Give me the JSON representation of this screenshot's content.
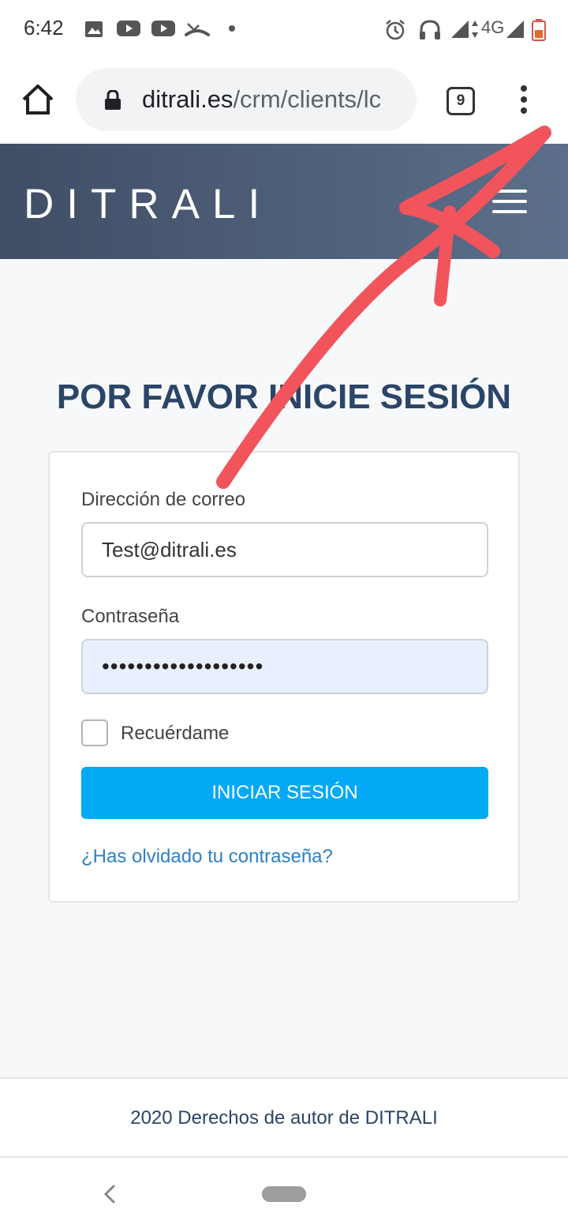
{
  "status_bar": {
    "time": "6:42",
    "network": "4G",
    "icons": [
      "image-icon",
      "youtube-icon",
      "youtube-icon",
      "missed-call-icon",
      "dot-icon",
      "alarm-icon",
      "headphones-icon",
      "signal-icon",
      "signal-icon",
      "battery-icon"
    ]
  },
  "browser": {
    "url_host": "ditrali.es",
    "url_path": "/crm/clients/lc",
    "tab_count": "9"
  },
  "site": {
    "logo": "DITRALI"
  },
  "login": {
    "title": "POR FAVOR INICIE SESIÓN",
    "email_label": "Dirección de correo",
    "email_value": "Test@ditrali.es",
    "password_label": "Contraseña",
    "password_value": "•••••••••••••••••••",
    "remember_label": "Recuérdame",
    "remember_checked": false,
    "submit_label": "INICIAR SESIÓN",
    "forgot_link": "¿Has olvidado tu contraseña?"
  },
  "footer": {
    "text": "2020 Derechos de autor de DITRALI"
  },
  "colors": {
    "header_bg": "#4f6079",
    "accent_button": "#03a9f4",
    "title": "#2a4568",
    "link": "#2f80c5",
    "annotation_stroke": "#f2545b"
  }
}
